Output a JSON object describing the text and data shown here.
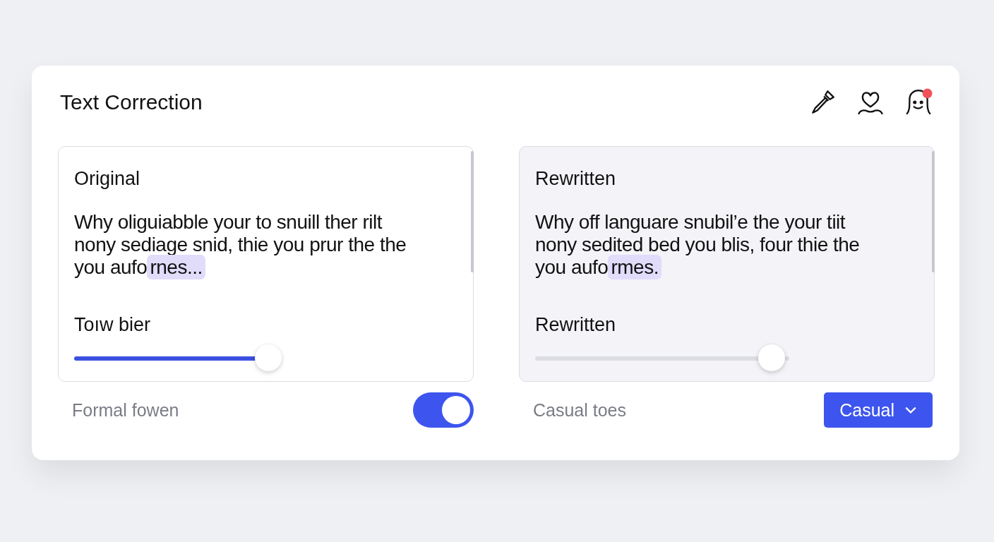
{
  "title": "Text Correction",
  "header_icons": [
    {
      "kind": "dropper"
    },
    {
      "kind": "heart-person"
    },
    {
      "kind": "ghost",
      "badge": true
    }
  ],
  "panels": [
    {
      "kind": "plain",
      "heading": "Original",
      "lines": [
        "Why oliguiabble your to snuill ther rilt",
        "nony sediage snid, thie you prur the the",
        "you aufo"
      ],
      "highlight": "rnes...",
      "slider_label": "Toıw bier",
      "slider": {
        "level": 0.93,
        "active": true
      },
      "footer_label": "Formal fowen",
      "control": {
        "kind": "toggle",
        "on": true
      }
    },
    {
      "kind": "tinted",
      "heading": "Rewritten",
      "lines": [
        "Why off  languare snubil’e the your tiit",
        "nony sedited bed you blis,  four  thie the",
        "you aufo"
      ],
      "highlight": "rmes.",
      "slider_label": "Rewritten",
      "slider": {
        "level": 0.93,
        "active": false
      },
      "footer_label": "Casual toes",
      "control": {
        "kind": "dropdown",
        "value": "Casual"
      }
    }
  ]
}
